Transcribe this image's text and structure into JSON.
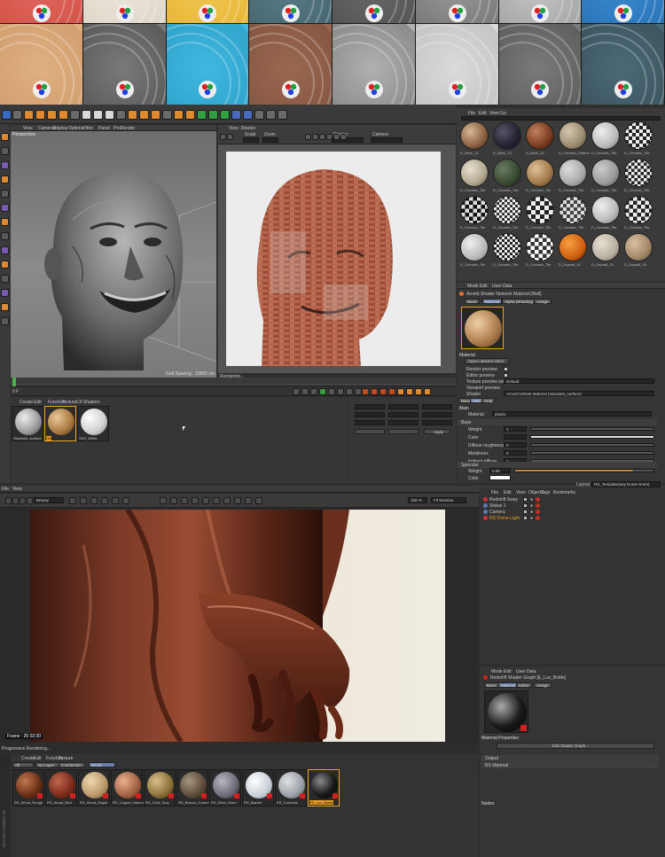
{
  "c4d_top": {
    "viewport_menu": [
      "View",
      "Cameras",
      "Display",
      "Options",
      "Filter",
      "Panel",
      "ProRender"
    ],
    "viewport_label": "Perspective",
    "viewport_footer": "Grid Spacing : 10000 cm",
    "render_view_menu": [
      "View",
      "Render"
    ],
    "render_view_fields": [
      "Scale",
      "Zoom",
      "Display",
      "Camera"
    ],
    "render_status": "Rendering...",
    "timeline_frame": "0 F",
    "material_manager_menu": [
      "Create",
      "Edit",
      "Function",
      "Texture",
      "C4 Shaders"
    ],
    "material_items": [
      "Standard_surface",
      "Dirt",
      "SSS_White"
    ],
    "browser_menu": [
      "File",
      "Edit",
      "View",
      "Go"
    ],
    "browser_items": [
      "D_Brick_12",
      "D_Brick_13",
      "D_Brick_14",
      "D_Ceramic_Pattern",
      "D_Ceramic_Tile",
      "D_Ceramic_Tile",
      "D_Ceramic_Tile",
      "D_Ceramic_Tile",
      "D_Ceramic_Tile",
      "D_Ceramic_Tile",
      "D_Ceramic_Tile",
      "D_Ceramic_Tile",
      "D_Ceramic_Tile",
      "D_Ceramic_Tile",
      "D_Ceramic_Tile",
      "D_Ceramic_Tile",
      "D_Ceramic_Tile",
      "D_Ceramic_Tile",
      "D_Ceramic_Tile",
      "D_Ceramic_Tile",
      "D_Ceramic_Tile",
      "D_Drywall_01",
      "D_Drywall_02",
      "D_Drywall_03"
    ],
    "attr_menu": [
      "Mode",
      "Edit",
      "User Data"
    ],
    "attr_title": "Arnold Shader Network Material [Wall]",
    "attr_tabs": [
      "Basic",
      "Material",
      "Alpha (Shading)",
      "Assign"
    ],
    "attr_section_material": "Material",
    "attr_open_editor": "Open network editor",
    "attr_rows": [
      {
        "label": "Render preview",
        "value": ""
      },
      {
        "label": "Editor preview",
        "value": ""
      },
      {
        "label": "Texture preview size",
        "value": "Default"
      },
      {
        "label": "Viewport preview",
        "value": ""
      },
      {
        "label": "Shader",
        "value": "Arnold Default Material (standard_surface)"
      }
    ],
    "attr_subtabs": [
      "Basic",
      "Main",
      "Help"
    ],
    "attr_section_main": "Main",
    "attr_material_label": "Material",
    "attr_material_value": "plastic",
    "attr_section_base": "Base",
    "attr_base_rows": [
      "Weight",
      "Color",
      "Diffuse roughness",
      "Metalness",
      "Indirect diffuse"
    ],
    "attr_base_values": [
      "1",
      "",
      "0",
      "0",
      "1"
    ],
    "attr_section_specular": "Specular",
    "attr_spec_rows": [
      "Weight",
      "Color"
    ],
    "attr_spec_values": [
      "0.85",
      ""
    ],
    "coord_buttons": [
      "Apply"
    ]
  },
  "c4d_bottom": {
    "menu": [
      "File",
      "View"
    ],
    "layout_label": "Layout",
    "layout_value": "RS_Template(any Dome Sram)",
    "render_channel": "Beauty",
    "render_zoom": "100 %",
    "render_mode": "Fit Window",
    "frame_label": "Frame : 26 02:30",
    "progress_label": "Progressive Rendering...",
    "material_menu": [
      "Create",
      "Edit",
      "Function",
      "Texture"
    ],
    "material_tabs": [
      "All",
      "No Layer",
      "Conduction",
      "Wood"
    ],
    "material_items": [
      "RS_Wood_Rough",
      "RS_Wood_Red",
      "RS_Wood_Maple",
      "RS_Copper_Hammer",
      "RS_Gold_Dirty",
      "RS_Bronze_Carved",
      "RS_Steel_Worn",
      "RS_Marble",
      "RS_Concrete",
      "RS_Lux_Bottle"
    ],
    "obj_menu": [
      "File",
      "Edit",
      "View",
      "Objects",
      "Tags",
      "Bookmarks"
    ],
    "objects": [
      "Redshift Sway",
      "Statue 1",
      "Camera",
      "RS Dome Light"
    ],
    "attr_menu": [
      "Mode",
      "Edit",
      "User Data"
    ],
    "attr_title": "Redshift Shader Graph [E_Lux_Bottle]",
    "attr_tabs": [
      "Basic",
      "Material",
      "Editor",
      "Assign"
    ],
    "attr_section": "Material Properties",
    "attr_edit_button": "Edit Shader Graph...",
    "attr_rows": [
      "Output",
      "RS Material"
    ],
    "nodes_label": "Nodes",
    "vertical_brand": "MAXON CINEMA 4D"
  },
  "colors": {
    "accent": "#f0a020",
    "panel": "#333333",
    "active_tab": "#6a7fa8"
  }
}
